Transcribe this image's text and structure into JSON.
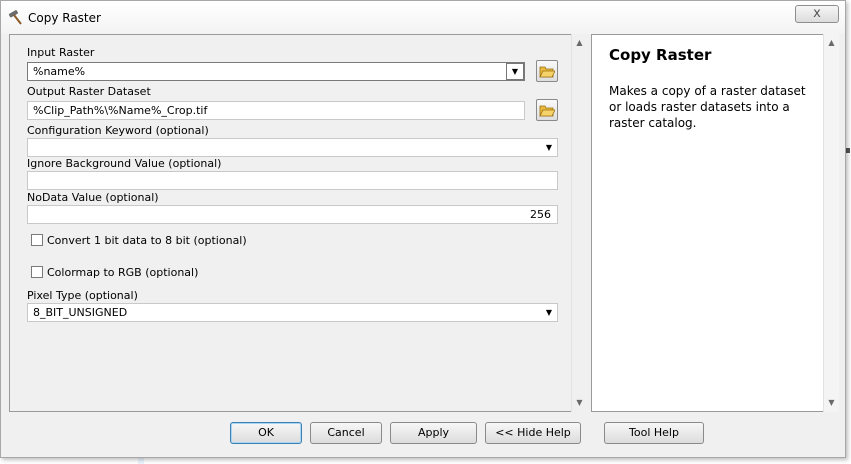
{
  "window": {
    "title": "Copy Raster",
    "close_label": "x"
  },
  "params": {
    "input_raster": {
      "label": "Input Raster",
      "value": "%name%"
    },
    "output_raster": {
      "label": "Output Raster Dataset",
      "value": "%Clip_Path%\\%Name%_Crop.tif"
    },
    "config_keyword": {
      "label": "Configuration Keyword (optional)",
      "value": ""
    },
    "ignore_background": {
      "label": "Ignore Background Value (optional)",
      "value": ""
    },
    "nodata": {
      "label": "NoData Value (optional)",
      "value": "256"
    },
    "convert_1bit": {
      "label": "Convert 1 bit data to 8 bit (optional)",
      "checked": false
    },
    "colormap_rgb": {
      "label": "Colormap to RGB (optional)",
      "checked": false
    },
    "pixel_type": {
      "label": "Pixel Type (optional)",
      "value": "8_BIT_UNSIGNED"
    }
  },
  "help": {
    "title": "Copy Raster",
    "description": "Makes a copy of a raster dataset or loads raster datasets into a raster catalog."
  },
  "buttons": {
    "ok": "OK",
    "cancel": "Cancel",
    "apply": "Apply",
    "hide_help": "<< Hide Help",
    "tool_help": "Tool Help"
  }
}
